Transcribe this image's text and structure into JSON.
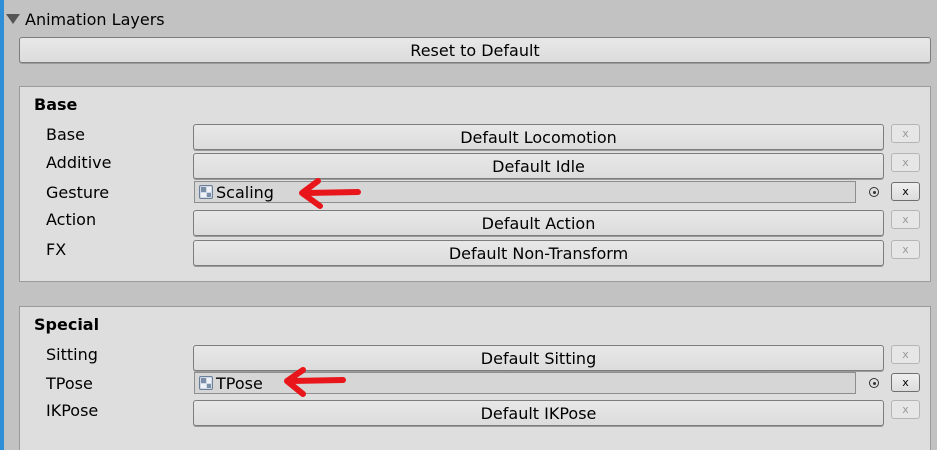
{
  "header": {
    "foldout_label": "Animation Layers"
  },
  "reset_button": {
    "label": "Reset to Default"
  },
  "base_panel": {
    "title": "Base",
    "rows": [
      {
        "label": "Base",
        "value": "Default Locomotion",
        "type": "button"
      },
      {
        "label": "Additive",
        "value": "Default Idle",
        "type": "button"
      },
      {
        "label": "Gesture",
        "value": "Scaling",
        "type": "object-field"
      },
      {
        "label": "Action",
        "value": "Default Action",
        "type": "button"
      },
      {
        "label": "FX",
        "value": "Default Non-Transform",
        "type": "button"
      }
    ]
  },
  "special_panel": {
    "title": "Special",
    "rows": [
      {
        "label": "Sitting",
        "value": "Default Sitting",
        "type": "button"
      },
      {
        "label": "TPose",
        "value": "TPose",
        "type": "object-field"
      },
      {
        "label": "IKPose",
        "value": "Default IKPose",
        "type": "button"
      }
    ]
  },
  "clear_button_label": "x",
  "icons": {
    "foldout": "triangle-down-icon",
    "object": "animator-controller-icon",
    "picker": "object-picker-icon",
    "annotation": "red-arrow-icon"
  },
  "colors": {
    "accent_stripe": "#2f8ed8",
    "annotation_arrow": "#e8161b",
    "panel_bg": "#dedede",
    "window_bg": "#c2c2c2"
  }
}
